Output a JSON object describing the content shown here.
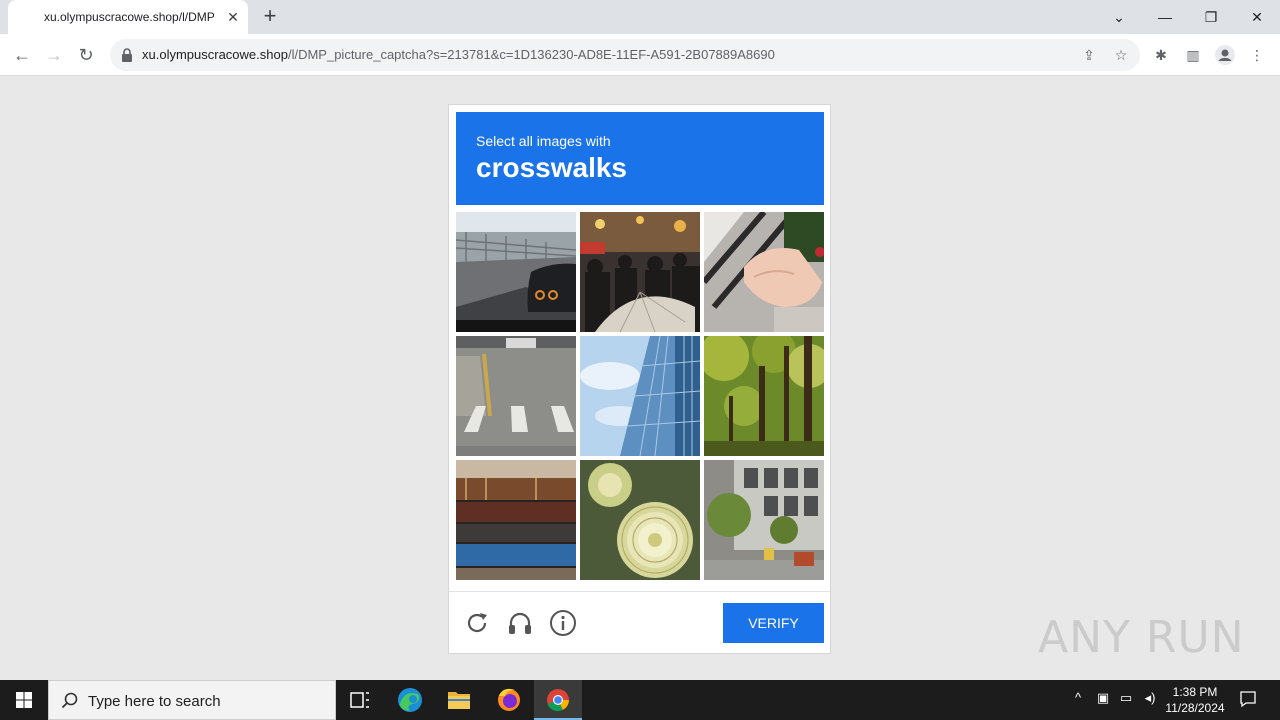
{
  "browser": {
    "tab_title": "xu.olympuscracowe.shop/l/DMP",
    "url_host": "xu.olympuscracowe.shop",
    "url_path": "/l/DMP_picture_captcha?s=213781&c=1D136230-AD8E-11EF-A591-2B07889A8690"
  },
  "captcha": {
    "prompt": "Select all images with",
    "keyword": "crosswalks",
    "tiles": [
      "highway-car-icon",
      "crowd-umbrella-icon",
      "hand-plant-icon",
      "crosswalk-street-icon",
      "glass-building-icon",
      "forest-trees-icon",
      "old-books-icon",
      "succulent-plant-icon",
      "city-street-icon"
    ],
    "verify_label": "VERIFY",
    "colors": {
      "accent": "#1a73e8"
    }
  },
  "watermark": "ANY RUN",
  "taskbar": {
    "search_placeholder": "Type here to search",
    "time": "1:38 PM",
    "date": "11/28/2024"
  }
}
